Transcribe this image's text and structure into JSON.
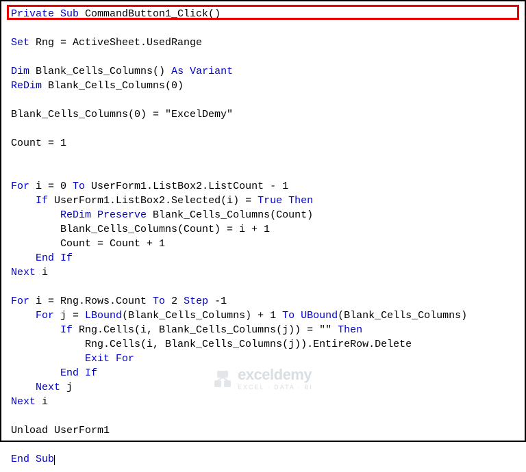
{
  "code": {
    "l1_kw1": "Private Sub",
    "l1_rest": " CommandButton1_Click()",
    "l3_kw1": "Set",
    "l3_rest": " Rng = ActiveSheet.UsedRange",
    "l5_kw1": "Dim",
    "l5_mid": " Blank_Cells_Columns() ",
    "l5_kw2": "As Variant",
    "l6_kw1": "ReDim",
    "l6_rest": " Blank_Cells_Columns(0)",
    "l8": "Blank_Cells_Columns(0) = \"ExcelDemy\"",
    "l10": "Count = 1",
    "l13_kw1": "For",
    "l13_mid": " i = 0 ",
    "l13_kw2": "To",
    "l13_rest": " UserForm1.ListBox2.ListCount - 1",
    "l14_pre": "    ",
    "l14_kw1": "If",
    "l14_mid": " UserForm1.ListBox2.Selected(i) = ",
    "l14_kw2": "True Then",
    "l15_pre": "        ",
    "l15_kw1": "ReDim Preserve",
    "l15_rest": " Blank_Cells_Columns(Count)",
    "l16": "        Blank_Cells_Columns(Count) = i + 1",
    "l17": "        Count = Count + 1",
    "l18_pre": "    ",
    "l18_kw1": "End If",
    "l19_kw1": "Next",
    "l19_rest": " i",
    "l21_kw1": "For",
    "l21_mid": " i = Rng.Rows.Count ",
    "l21_kw2": "To",
    "l21_mid2": " 2 ",
    "l21_kw3": "Step",
    "l21_rest": " -1",
    "l22_pre": "    ",
    "l22_kw1": "For",
    "l22_mid": " j = ",
    "l22_kw2": "LBound",
    "l22_mid2": "(Blank_Cells_Columns) + 1 ",
    "l22_kw3": "To",
    "l22_mid3": " ",
    "l22_kw4": "UBound",
    "l22_rest": "(Blank_Cells_Columns)",
    "l23_pre": "        ",
    "l23_kw1": "If",
    "l23_mid": " Rng.Cells(i, Blank_Cells_Columns(j)) = \"\" ",
    "l23_kw2": "Then",
    "l24": "            Rng.Cells(i, Blank_Cells_Columns(j)).EntireRow.Delete",
    "l25_pre": "            ",
    "l25_kw1": "Exit For",
    "l26_pre": "        ",
    "l26_kw1": "End If",
    "l27_pre": "    ",
    "l27_kw1": "Next",
    "l27_rest": " j",
    "l28_kw1": "Next",
    "l28_rest": " i",
    "l30": "Unload UserForm1",
    "l32_kw1": "End Sub"
  },
  "watermark": {
    "main": "exceldemy",
    "sub": "EXCEL · DATA · BI"
  }
}
